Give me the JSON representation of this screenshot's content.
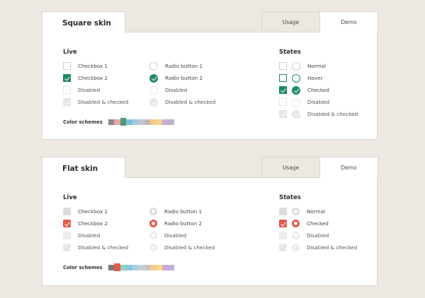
{
  "square_skin": {
    "title": "Square skin",
    "tabs": {
      "usage": "Usage",
      "demo": "Demo"
    },
    "live": {
      "heading": "Live",
      "checkboxes": [
        "Checkbox 1",
        "Checkbox 2",
        "Disabled",
        "Disabled & checked"
      ],
      "radios": [
        "Radio button 1",
        "Radio button 2",
        "Disabled",
        "Disabled & checked"
      ]
    },
    "states": {
      "heading": "States",
      "items": [
        "Normal",
        "Hover",
        "Checked",
        "Disabled",
        "Disabled & checked"
      ]
    },
    "color_schemes_label": "Color schemes",
    "swatches": [
      "#8a8a8a",
      "#e7a5a5",
      "#4f9a7a",
      "#7ec2d8",
      "#9fc8e6",
      "#c2c8d2",
      "#b9b9b9",
      "#f7c98a",
      "#f1d58a",
      "#c9a9cf",
      "#b7b1d2"
    ],
    "active_swatch": 2,
    "accent": "#1f8a66"
  },
  "flat_skin": {
    "title": "Flat skin",
    "tabs": {
      "usage": "Usage",
      "demo": "Demo"
    },
    "live": {
      "heading": "Live",
      "checkboxes": [
        "Checkbox 1",
        "Checkbox 2",
        "Disabled",
        "Disabled & checked"
      ],
      "radios": [
        "Radio button 1",
        "Radio button 2",
        "Disabled",
        "Disabled & checked"
      ]
    },
    "states": {
      "heading": "States",
      "items": [
        "Normal",
        "Checked",
        "Disabled",
        "Disabled & checked"
      ]
    },
    "color_schemes_label": "Color schemes",
    "swatches": [
      "#7a7a7a",
      "#e3594b",
      "#8fd0c0",
      "#86c8dc",
      "#a9cfe8",
      "#c9cfd8",
      "#c4c4c4",
      "#f7c98a",
      "#f4dc8a",
      "#c9a9cf",
      "#bdb3d8"
    ],
    "active_swatch": 1,
    "accent": "#e3594b"
  }
}
